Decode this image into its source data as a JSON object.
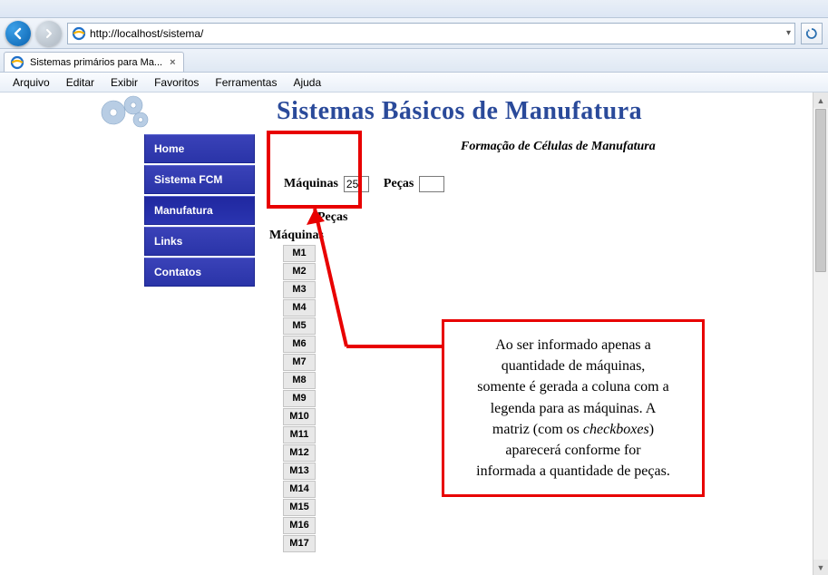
{
  "browser": {
    "url": "http://localhost/sistema/",
    "tab_title": "Sistemas primários para Ma...",
    "menus": [
      "Arquivo",
      "Editar",
      "Exibir",
      "Favoritos",
      "Ferramentas",
      "Ajuda"
    ]
  },
  "header": {
    "title": "Sistemas Básicos de Manufatura",
    "subtitle": "Formação de Células de Manufatura"
  },
  "sidebar": {
    "items": [
      {
        "label": "Home"
      },
      {
        "label": "Sistema FCM"
      },
      {
        "label": "Manufatura"
      },
      {
        "label": "Links"
      },
      {
        "label": "Contatos"
      }
    ]
  },
  "form": {
    "maquinas_label": "Máquinas",
    "maquinas_value": "25",
    "pecas_label": "Peças",
    "pecas_value": ""
  },
  "matrix": {
    "pecas_header": "Peças",
    "maquinas_header": "Máquinas",
    "machines": [
      "M1",
      "M2",
      "M3",
      "M4",
      "M5",
      "M6",
      "M7",
      "M8",
      "M9",
      "M10",
      "M11",
      "M12",
      "M13",
      "M14",
      "M15",
      "M16",
      "M17"
    ]
  },
  "callout": {
    "line1": "Ao ser informado apenas a",
    "line2": "quantidade de máquinas,",
    "line3": "somente é gerada a coluna com a",
    "line4": "legenda para as máquinas. A",
    "line5a": "matriz (com os ",
    "line5b": "checkboxes",
    "line5c": ")",
    "line6": "aparecerá conforme for",
    "line7": "informada a quantidade de peças."
  }
}
